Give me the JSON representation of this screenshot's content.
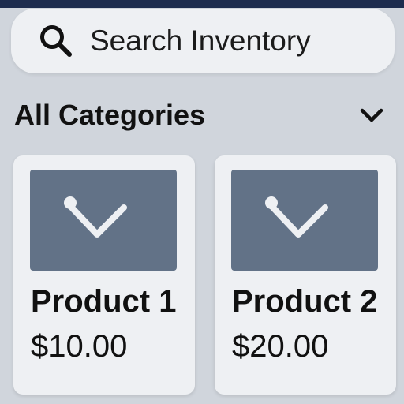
{
  "search": {
    "placeholder": "Search Inventory",
    "icon": "search-icon"
  },
  "filter": {
    "selected": "All Categories",
    "icon": "chevron-down-icon"
  },
  "products": [
    {
      "name": "Product 1",
      "price": "$10.00",
      "image_icon": "image-placeholder-icon"
    },
    {
      "name": "Product 2",
      "price": "$20.00",
      "image_icon": "image-placeholder-icon"
    }
  ],
  "colors": {
    "header": "#1d2c4e",
    "background": "#d0d5dc",
    "card": "#eef0f3",
    "thumbnail": "#627287"
  }
}
